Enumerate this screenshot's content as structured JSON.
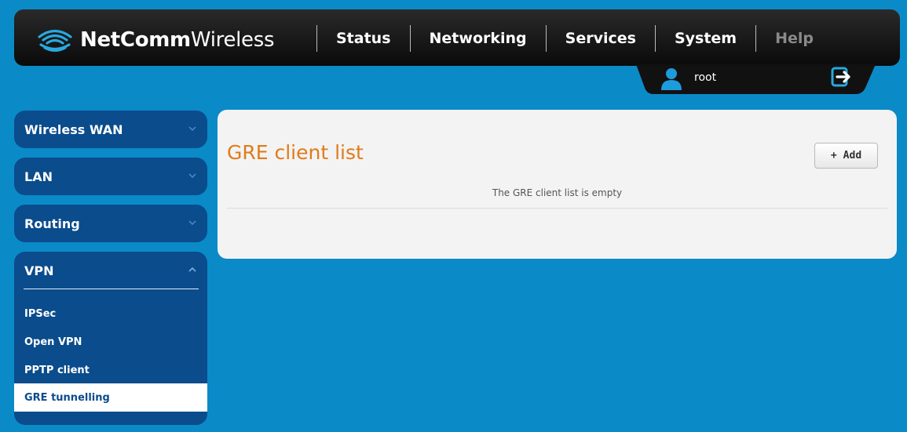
{
  "brand": {
    "name_bold": "NetComm",
    "name_light": "Wireless"
  },
  "nav": {
    "items": [
      {
        "label": "Status"
      },
      {
        "label": "Networking"
      },
      {
        "label": "Services"
      },
      {
        "label": "System"
      },
      {
        "label": "Help"
      }
    ]
  },
  "user": {
    "name": "root"
  },
  "sidebar": {
    "groups": [
      {
        "label": "Wireless WAN",
        "expanded": false
      },
      {
        "label": "LAN",
        "expanded": false
      },
      {
        "label": "Routing",
        "expanded": false
      },
      {
        "label": "VPN",
        "expanded": true
      }
    ],
    "vpn_items": [
      {
        "label": "IPSec"
      },
      {
        "label": "Open VPN"
      },
      {
        "label": "PPTP client"
      },
      {
        "label": "GRE tunnelling",
        "active": true
      }
    ]
  },
  "main": {
    "title": "GRE client list",
    "add_label": "Add",
    "add_icon": "plus-icon",
    "empty_message": "The GRE client list is empty"
  },
  "colors": {
    "background": "#0b8ac8",
    "sidebar": "#0a4c8c",
    "title": "#e07b1a",
    "header": "#111111"
  }
}
